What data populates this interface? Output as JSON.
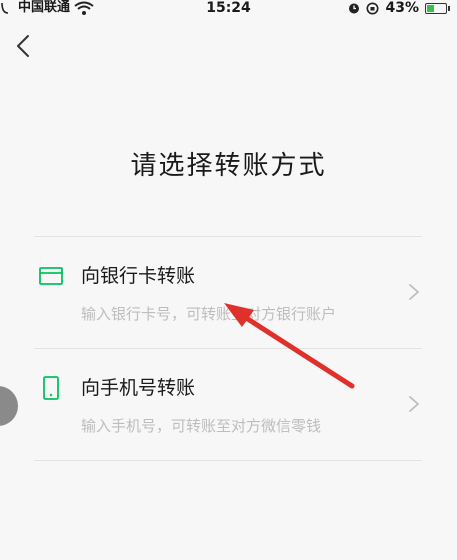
{
  "status_bar": {
    "carrier": "中国联通",
    "time": "15:24",
    "battery": "43%",
    "battery_level": 0.43
  },
  "page": {
    "title": "请选择转账方式"
  },
  "options": [
    {
      "title": "向银行卡转账",
      "subtitle": "输入银行卡号，可转账至对方银行账户",
      "icon": "bank-card-icon"
    },
    {
      "title": "向手机号转账",
      "subtitle": "输入手机号，可转账至对方微信零钱",
      "icon": "phone-icon"
    }
  ],
  "colors": {
    "accent": "#07c160",
    "annotation_arrow": "#e0302b",
    "subtitle": "#bdbdbd",
    "background": "#f7f7f7"
  }
}
